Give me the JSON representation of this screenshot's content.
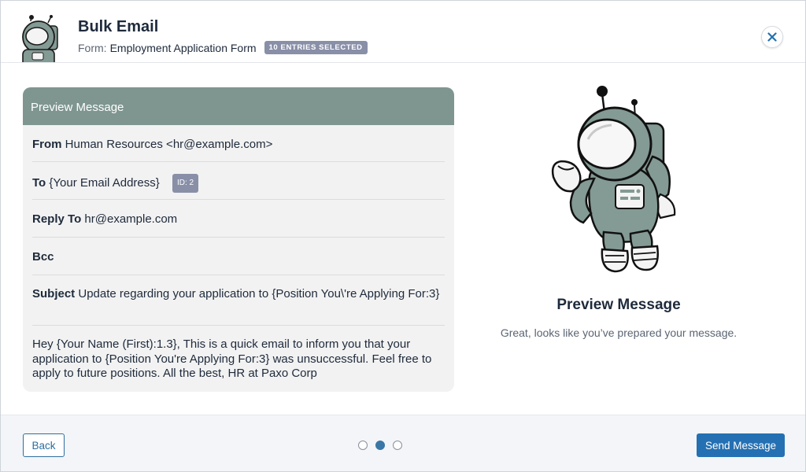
{
  "header": {
    "title": "Bulk Email",
    "form_label": "Form:",
    "form_name": "Employment Application Form",
    "entries_badge": "10 ENTRIES SELECTED"
  },
  "preview": {
    "heading": "Preview Message",
    "from_label": "From",
    "from_value": "Human Resources <hr@example.com>",
    "to_label": "To",
    "to_value": "{Your Email Address}",
    "to_id_badge": "ID: 2",
    "reply_to_label": "Reply To",
    "reply_to_value": "hr@example.com",
    "bcc_label": "Bcc",
    "subject_label": "Subject",
    "subject_value": "Update regarding your application to {Position You\\'re Applying For:3}",
    "body": "Hey {Your Name (First):1.3}, This is a quick email to inform you that your application to {Position You're Applying For:3} was unsuccessful. Feel free to apply to future positions. All the best, HR at Paxo Corp"
  },
  "side": {
    "title": "Preview Message",
    "subtitle": "Great, looks like you’ve prepared your message."
  },
  "footer": {
    "back_label": "Back",
    "send_label": "Send Message",
    "steps_total": 3,
    "steps_active": 2
  },
  "colors": {
    "accent": "#2470b3",
    "card_header": "#7f9690",
    "badge": "#8a8fa8"
  },
  "icons": {
    "close": "close-icon",
    "mascot": "astronaut-icon"
  }
}
